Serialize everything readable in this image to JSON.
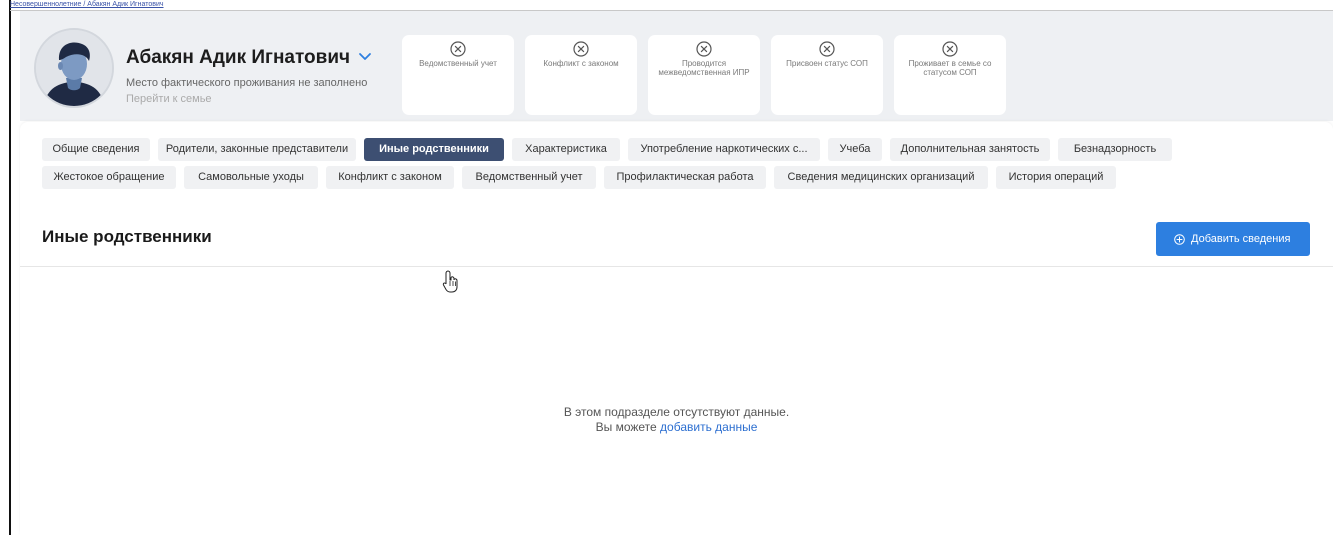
{
  "breadcrumb": "Несовершеннолетние / Абакян Адик Игнатович",
  "person": {
    "name": "Абакян Адик Игнатович",
    "address": "Место фактического проживания не заполнено",
    "family_link": "Перейти к семье"
  },
  "status_cards": [
    {
      "label": "Ведомственный учет",
      "icon": "x-circle-icon"
    },
    {
      "label": "Конфликт с законом",
      "icon": "x-circle-icon"
    },
    {
      "label": "Проводится межведомственная ИПР",
      "icon": "x-circle-icon"
    },
    {
      "label": "Присвоен статус СОП",
      "icon": "x-circle-icon"
    },
    {
      "label": "Проживает в семье со статусом СОП",
      "icon": "x-circle-icon"
    }
  ],
  "tabs_row1": [
    {
      "label": "Общие сведения"
    },
    {
      "label": "Родители, законные представители"
    },
    {
      "label": "Иные родственники"
    },
    {
      "label": "Характеристика"
    },
    {
      "label": "Употребление наркотических с..."
    },
    {
      "label": "Учеба"
    },
    {
      "label": "Дополнительная занятость"
    },
    {
      "label": "Безнадзорность"
    }
  ],
  "tabs_row2": [
    {
      "label": "Жестокое обращение"
    },
    {
      "label": "Самовольные уходы"
    },
    {
      "label": "Конфликт с законом"
    },
    {
      "label": "Ведомственный учет"
    },
    {
      "label": "Профилактическая работа"
    },
    {
      "label": "Сведения медицинских организаций"
    },
    {
      "label": "История операций"
    }
  ],
  "active_tab": "Иные родственники",
  "section": {
    "title": "Иные родственники",
    "add_button": "Добавить сведения"
  },
  "empty": {
    "line1": "В этом подразделе отсутствуют данные.",
    "line2_prefix": "Вы можете",
    "line2_link": "добавить данные"
  },
  "colors": {
    "accent": "#2d7fe0",
    "active_tab": "#3d4f72",
    "link": "#2d6fd0"
  }
}
